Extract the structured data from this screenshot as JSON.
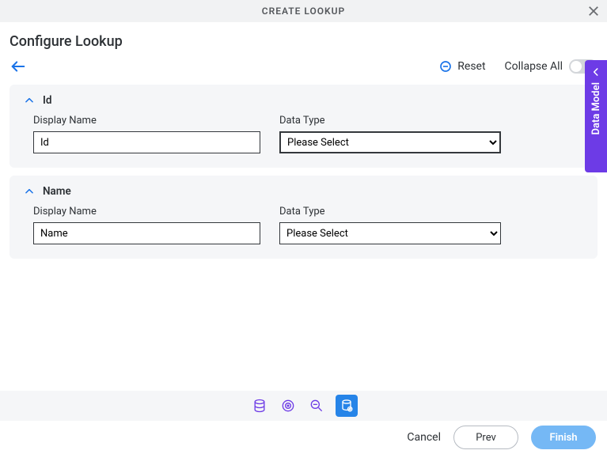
{
  "titleBar": {
    "title": "CREATE LOOKUP"
  },
  "page": {
    "heading": "Configure Lookup"
  },
  "toolbar": {
    "resetLabel": "Reset",
    "collapseAllLabel": "Collapse All"
  },
  "sections": [
    {
      "title": "Id",
      "displayNameLabel": "Display Name",
      "displayNameValue": "Id",
      "dataTypeLabel": "Data Type",
      "dataTypePlaceholder": "Please Select"
    },
    {
      "title": "Name",
      "displayNameLabel": "Display Name",
      "displayNameValue": "Name",
      "dataTypeLabel": "Data Type",
      "dataTypePlaceholder": "Please Select"
    }
  ],
  "sideTab": {
    "label": "Data Model"
  },
  "footer": {
    "cancelLabel": "Cancel",
    "prevLabel": "Prev",
    "finishLabel": "Finish"
  }
}
